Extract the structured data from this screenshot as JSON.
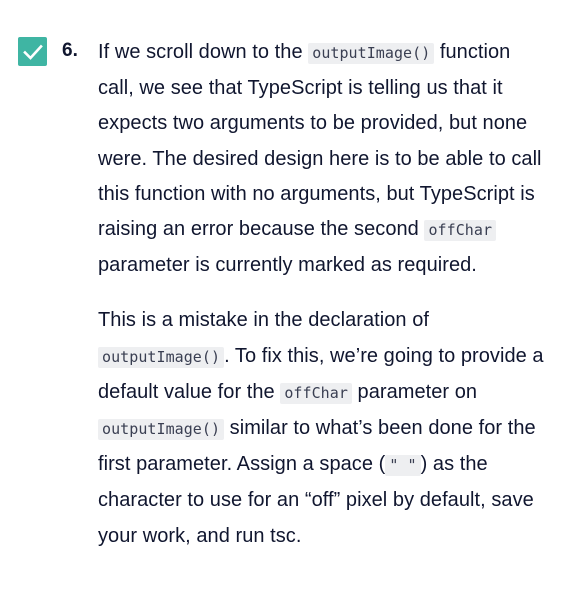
{
  "task": {
    "completed": true,
    "check_color": "#3fb5a3",
    "number": "6.",
    "paragraphs": [
      {
        "segments": [
          {
            "type": "text",
            "value": "If we scroll down to the "
          },
          {
            "type": "code",
            "value": "outputImage()"
          },
          {
            "type": "text",
            "value": " function call, we see that TypeScript is telling us that it expects two arguments to be provided, but none were. The desired design here is to be able to call this function with no arguments, but TypeScript is raising an error because the second "
          },
          {
            "type": "code",
            "value": "offChar"
          },
          {
            "type": "text",
            "value": " parameter is currently marked as required."
          }
        ]
      },
      {
        "segments": [
          {
            "type": "text",
            "value": "This is a mistake in the declaration of "
          },
          {
            "type": "code",
            "value": "outputImage()"
          },
          {
            "type": "text",
            "value": ". To fix this, we’re going to provide a default value for the "
          },
          {
            "type": "code",
            "value": "offChar"
          },
          {
            "type": "text",
            "value": " parameter on "
          },
          {
            "type": "code",
            "value": "outputImage()"
          },
          {
            "type": "text",
            "value": " similar to what’s been done for the first parameter. Assign a space ("
          },
          {
            "type": "code",
            "value": "\" \""
          },
          {
            "type": "text",
            "value": ") as the character to use for an “off” pixel by default, save your work, and run tsc."
          }
        ]
      }
    ]
  }
}
